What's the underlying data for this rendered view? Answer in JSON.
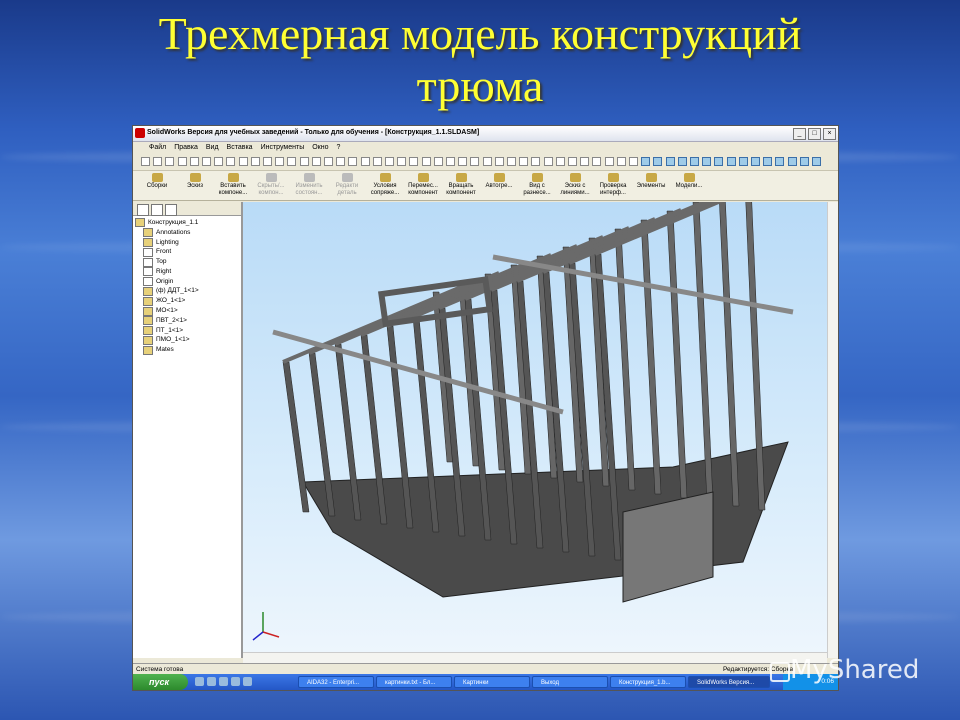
{
  "slide": {
    "title_line1": "Трехмерная модель конструкций",
    "title_line2": "трюма"
  },
  "window": {
    "title": "SolidWorks Версия для учебных заведений - Только для обучения - [Конструкция_1.1.SLDASM]",
    "controls": [
      "_",
      "□",
      "×"
    ]
  },
  "menu": [
    "Файл",
    "Правка",
    "Вид",
    "Вставка",
    "Инструменты",
    "Окно",
    "?"
  ],
  "command_manager": [
    {
      "label": "Сборки",
      "dim": false
    },
    {
      "label": "Эскиз",
      "dim": false
    },
    {
      "label": "Вставить компоне...",
      "dim": false
    },
    {
      "label": "Скрыть/... компон...",
      "dim": true
    },
    {
      "label": "Изменить состоян...",
      "dim": true
    },
    {
      "label": "Редакти деталь",
      "dim": true
    },
    {
      "label": "Условия сопряже...",
      "dim": false
    },
    {
      "label": "Перемес... компонент",
      "dim": false
    },
    {
      "label": "Вращать компонент",
      "dim": false
    },
    {
      "label": "Автогре...",
      "dim": false
    },
    {
      "label": "Вид с разнесе...",
      "dim": false
    },
    {
      "label": "Эскиз с линиями...",
      "dim": false
    },
    {
      "label": "Проверка интерф...",
      "dim": false
    },
    {
      "label": "Элементы",
      "dim": false
    },
    {
      "label": "Модели...",
      "dim": false
    }
  ],
  "feature_tree": [
    {
      "label": "Конструкция_1.1"
    },
    {
      "label": "Annotations"
    },
    {
      "label": "Lighting"
    },
    {
      "label": "Front"
    },
    {
      "label": "Top"
    },
    {
      "label": "Right"
    },
    {
      "label": "Origin"
    },
    {
      "label": "(ф) ДДТ_1<1>"
    },
    {
      "label": "ЖО_1<1>"
    },
    {
      "label": "МО<1>"
    },
    {
      "label": "ПВТ_2<1>"
    },
    {
      "label": "ПТ_1<1>"
    },
    {
      "label": "ПМО_1<1>"
    },
    {
      "label": "Mates"
    }
  ],
  "status": {
    "left": "Система готова",
    "right": "Редактируется: Сборка"
  },
  "taskbar": {
    "start": "пуск",
    "tasks": [
      {
        "label": "AIDA32 - Enterpri...",
        "active": false
      },
      {
        "label": "картинки.txt - Бл...",
        "active": false
      },
      {
        "label": "Картинки",
        "active": false
      },
      {
        "label": "Выход",
        "active": false
      },
      {
        "label": "Конструкция_1.b...",
        "active": false
      },
      {
        "label": "SolidWorks Версия...",
        "active": true
      }
    ],
    "clock": "0:06"
  },
  "watermark": "MyShared",
  "colors": {
    "title": "#ffff33",
    "model": "#555555",
    "viewport": "#cfe6fa"
  }
}
